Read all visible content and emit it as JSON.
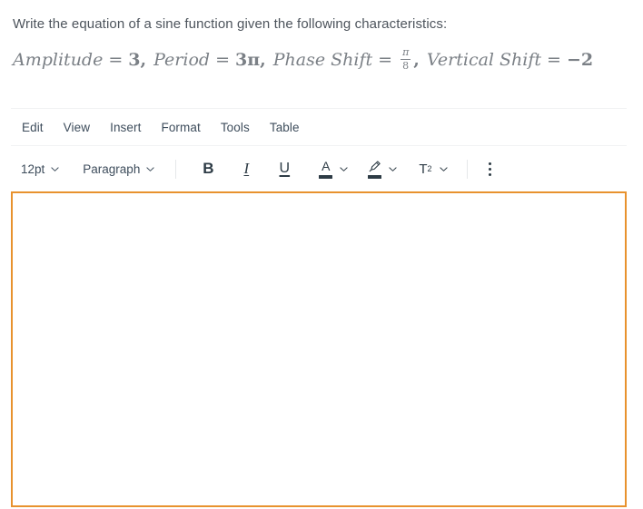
{
  "question": {
    "prompt": "Write the equation of a sine function given the following characteristics:",
    "equation_plain": "Amplitude = 3, Period = 3π, Phase Shift = π/8, Vertical Shift = −2",
    "equation_parts": {
      "amplitude_label": "Amplitude",
      "amplitude_eq": "=",
      "amplitude_value": "3",
      "comma1": ",",
      "period_label": "Period",
      "period_eq": "=",
      "period_value": "3π",
      "comma2": ",",
      "phase_label": "Phase Shift",
      "phase_eq": "=",
      "phase_numerator": "π",
      "phase_denominator": "8",
      "comma3": ",",
      "vertical_label": "Vertical Shift",
      "vertical_eq": "=",
      "vertical_value": "−2"
    }
  },
  "editor": {
    "menubar": [
      {
        "label": "Edit",
        "name": "menu-edit"
      },
      {
        "label": "View",
        "name": "menu-view"
      },
      {
        "label": "Insert",
        "name": "menu-insert"
      },
      {
        "label": "Format",
        "name": "menu-format"
      },
      {
        "label": "Tools",
        "name": "menu-tools"
      },
      {
        "label": "Table",
        "name": "menu-table"
      }
    ],
    "toolbar": {
      "font_size": "12pt",
      "block_format": "Paragraph",
      "bold_label": "B",
      "italic_label": "I",
      "underline_label": "U",
      "text_color_label": "A",
      "text_color_swatch": "#2d3b45",
      "highlight_color_swatch": "#2d3b45",
      "superscript_label": "T",
      "superscript_exponent": "2",
      "more_options_label": "⋮"
    },
    "content": {
      "value": "",
      "placeholder": ""
    },
    "focus_border_color": "#e8922e"
  },
  "colors": {
    "prompt_text": "#4d545c",
    "equation_text": "#7b8086",
    "menu_text": "#3e4d5c",
    "toolbar_icon": "#2d3b45",
    "divider": "#f1f2f3",
    "accent_orange": "#e8922e",
    "background": "#ffffff"
  }
}
